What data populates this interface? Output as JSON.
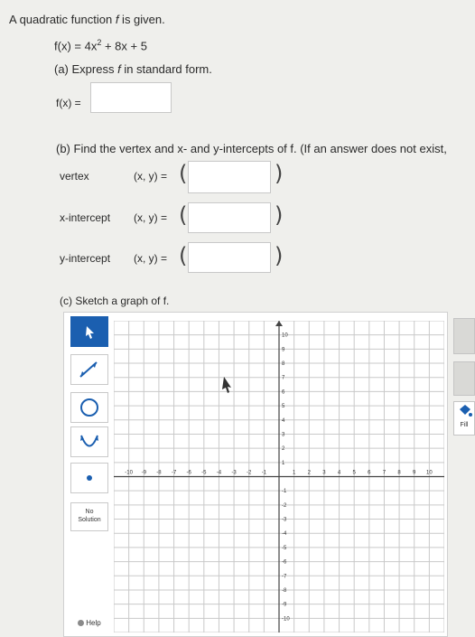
{
  "problem": {
    "intro_a": "A quadratic function ",
    "intro_f": "f",
    "intro_b": " is given.",
    "func_lhs": "f(x) = 4x",
    "func_exp": "2",
    "func_rhs": " + 8x + 5",
    "part_a_a": "(a) Express ",
    "part_a_f": "f",
    "part_a_b": " in standard form.",
    "fx_label": "f(x) =",
    "part_b": "(b) Find the vertex and x- and y-intercepts of f. (If an answer does not exist,",
    "vertex_label": "vertex",
    "xint_label": "x-intercept",
    "yint_label": "y-intercept",
    "xy_label": "(x, y) =",
    "part_c": "(c) Sketch a graph of f."
  },
  "toolbar": {
    "tools": [
      "pointer-icon",
      "line-icon",
      "circle-icon",
      "parabola-icon",
      "point-icon"
    ],
    "no_solution_line1": "No",
    "no_solution_line2": "Solution",
    "help": "Help"
  },
  "side": {
    "fill_label": "Fill"
  },
  "graph": {
    "x_ticks": [
      "-10",
      "-9",
      "-8",
      "-7",
      "-6",
      "-5",
      "-4",
      "-3",
      "-2",
      "-1",
      "1",
      "2",
      "3",
      "4",
      "5",
      "6",
      "7",
      "8",
      "9",
      "10"
    ],
    "y_ticks": [
      "10",
      "9",
      "8",
      "7",
      "6",
      "5",
      "4",
      "3",
      "2",
      "1",
      "-1",
      "-2",
      "-3",
      "-4",
      "-5",
      "-6",
      "-7",
      "-8",
      "-9",
      "-10"
    ],
    "xlim": [
      -11,
      11
    ],
    "ylim": [
      -11,
      11
    ]
  }
}
